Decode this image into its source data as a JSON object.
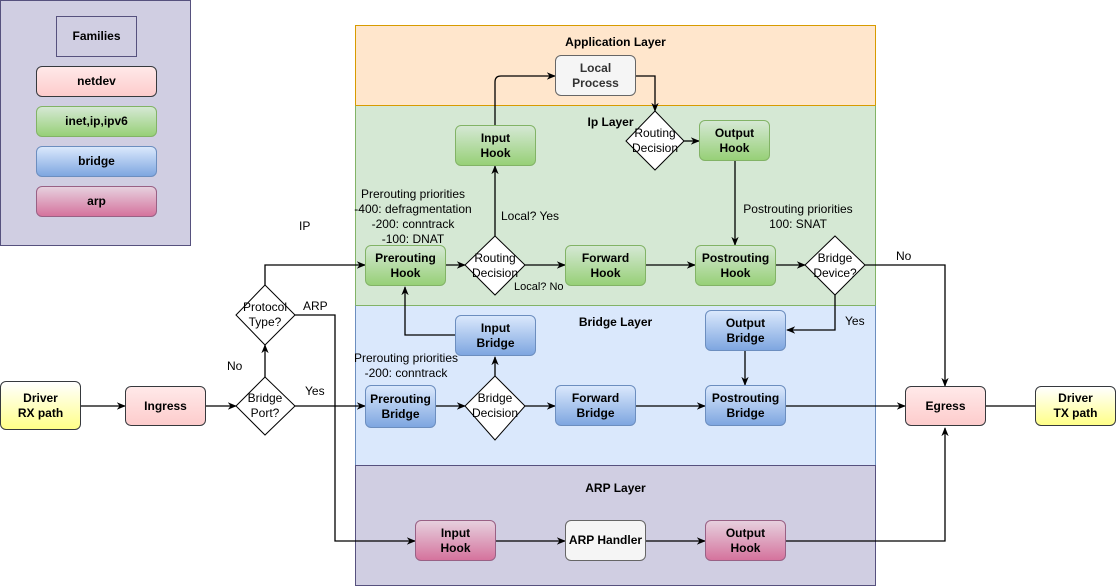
{
  "legend": {
    "title": "Families",
    "items": [
      {
        "label": "netdev",
        "family": "netdev"
      },
      {
        "label": "inet,ip,ipv6",
        "family": "inet"
      },
      {
        "label": "bridge",
        "family": "bridge"
      },
      {
        "label": "arp",
        "family": "arp"
      }
    ]
  },
  "layers": {
    "application": "Application Layer",
    "ip": "Ip Layer",
    "bridge": "Bridge Layer",
    "arp": "ARP Layer"
  },
  "nodes": {
    "driver_rx": "Driver\nRX path",
    "ingress": "Ingress",
    "egress": "Egress",
    "driver_tx": "Driver\nTX path",
    "local_process": "Local\nProcess",
    "ip_input_hook": "Input\nHook",
    "ip_output_hook": "Output\nHook",
    "ip_prerouting_hook": "Prerouting\nHook",
    "ip_forward_hook": "Forward\nHook",
    "ip_postrouting_hook": "Postrouting\nHook",
    "br_input": "Input\nBridge",
    "br_output": "Output\nBridge",
    "br_prerouting": "Prerouting\nBridge",
    "br_forward": "Forward\nBridge",
    "br_postrouting": "Postrouting\nBridge",
    "arp_input_hook": "Input\nHook",
    "arp_handler": "ARP Handler",
    "arp_output_hook": "Output\nHook"
  },
  "decisions": {
    "bridge_port": "Bridge\nPort?",
    "protocol_type": "Protocol\nType?",
    "routing_decision_pre": "Routing\nDecision",
    "routing_decision_out": "Routing\nDecision",
    "bridge_device": "Bridge\nDevice?",
    "bridge_decision": "Bridge\nDecision"
  },
  "annotations": {
    "ip_prerouting_priorities": "Prerouting priorities\n-400: defragmentation\n-200: conntrack\n-100: DNAT",
    "ip_postrouting_priorities": "Postrouting priorities\n100: SNAT",
    "br_prerouting_priorities": "Prerouting priorities\n-200: conntrack"
  },
  "edge_labels": {
    "ip": "IP",
    "arp": "ARP",
    "no_bridge_port": "No",
    "yes_bridge_port": "Yes",
    "local_yes": "Local? Yes",
    "local_no": "Local? No",
    "no_bridge_device": "No",
    "yes_bridge_device": "Yes"
  },
  "colors": {
    "application_layer": "#ffe6cc",
    "ip_layer": "#d5e8d4",
    "bridge_layer": "#dae8fc",
    "arp_layer": "#d0cee2",
    "legend_bg": "#d0cee2"
  }
}
